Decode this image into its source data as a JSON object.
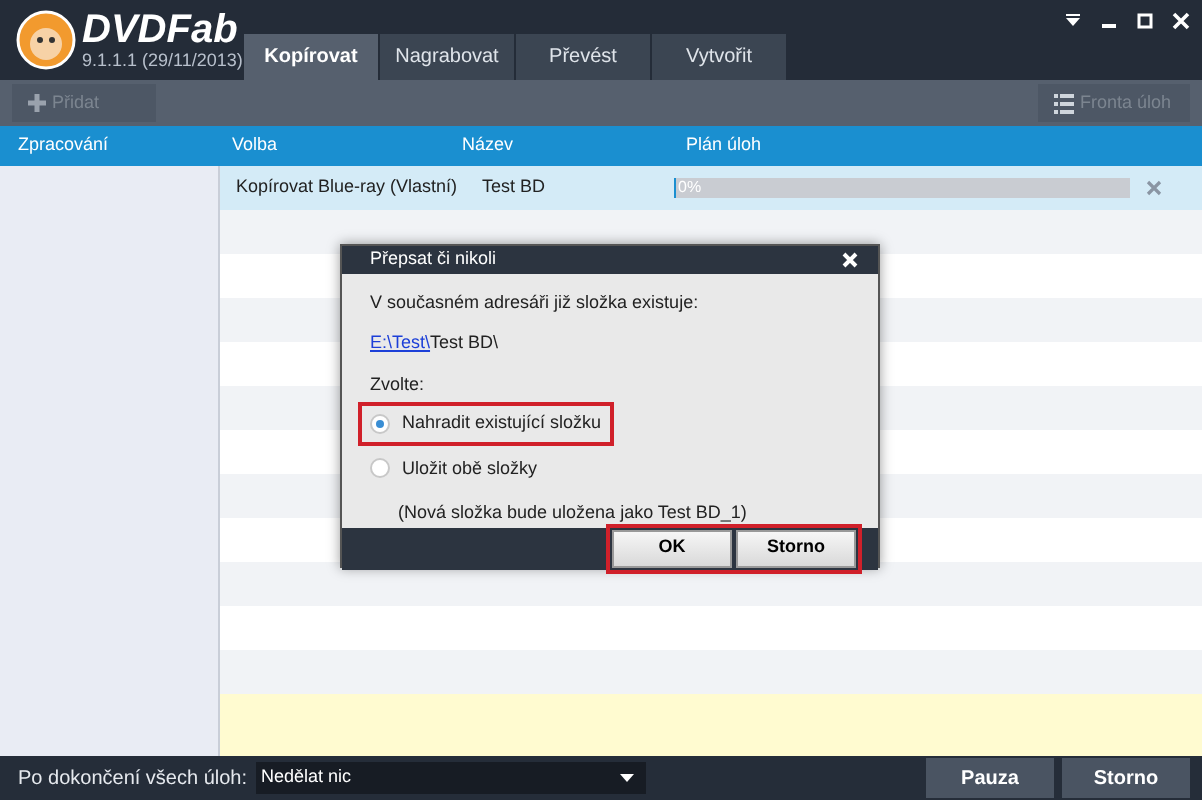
{
  "app": {
    "logo": "DVDFab",
    "version": "9.1.1.1 (29/11/2013)"
  },
  "tabs": [
    {
      "label": "Kopírovat",
      "selected": true
    },
    {
      "label": "Nagrabovat",
      "selected": false
    },
    {
      "label": "Převést",
      "selected": false
    },
    {
      "label": "Vytvořit",
      "selected": false
    }
  ],
  "toolbar": {
    "add_button": {
      "label": "Přidat",
      "disabled": true
    },
    "queue_button": {
      "label": "Fronta úloh",
      "disabled": true
    }
  },
  "sidebar": {
    "heading": "Zpracování"
  },
  "table": {
    "columns": [
      "Volba",
      "Název",
      "Plán úloh"
    ],
    "rows": [
      {
        "option": "Kopírovat Blue-ray (Vlastní)",
        "name": "Test BD",
        "level": 0,
        "reading": "0%",
        "selected": true
      }
    ]
  },
  "dialog": {
    "title": "Přepsat či nikoli",
    "message": "V současném adresáři již složka existuje:",
    "path_link": "E:\\Test\\",
    "path_rest": "Test BD\\",
    "prompt": "Zvolte:",
    "options": [
      {
        "label": "Nahradit existující složku",
        "selected": true,
        "highlighted": true
      },
      {
        "label": "Uložit obě složky",
        "selected": false,
        "highlighted": false
      }
    ],
    "note": "(Nová složka bude uložena jako Test BD_1)",
    "buttons": [
      "OK",
      "Storno"
    ],
    "buttons_highlighted": true
  },
  "bottom_bar": {
    "label": "Po dokončení všech úloh:",
    "select_value": "Nedělat nic",
    "buttons": [
      "Pauza",
      "Storno"
    ]
  }
}
